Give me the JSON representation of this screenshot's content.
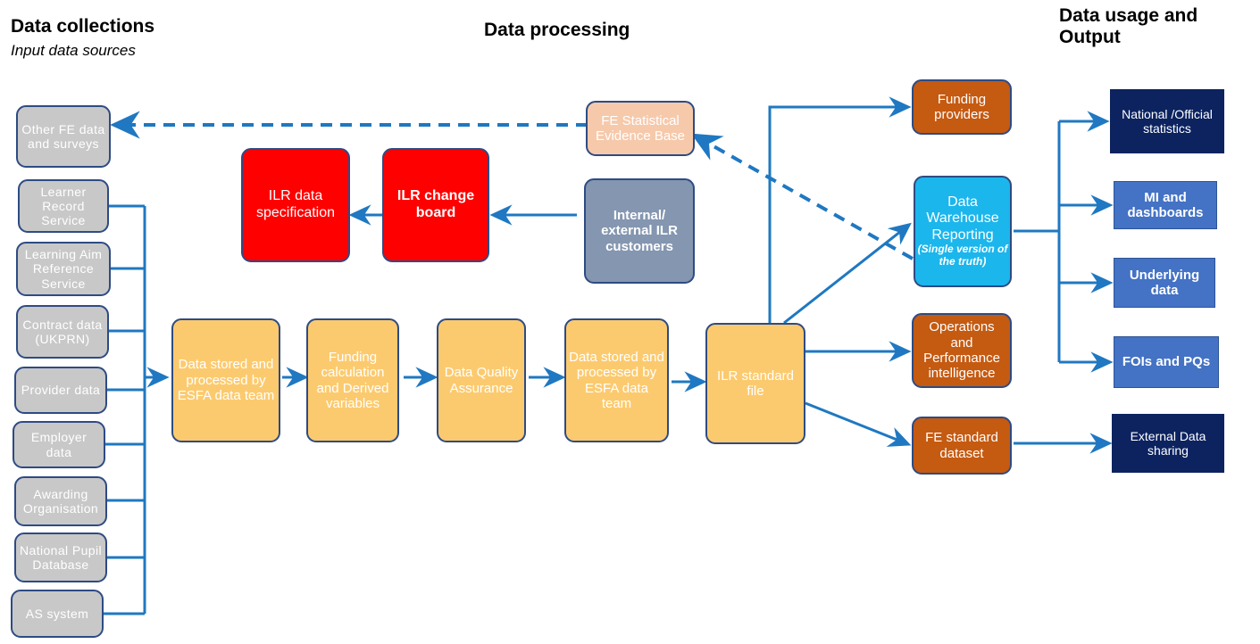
{
  "headers": [
    {
      "id": "data-collections",
      "title": "Data collections",
      "subtitle": "Input data sources"
    },
    {
      "id": "data-processing",
      "title": "Data processing",
      "subtitle": ""
    },
    {
      "id": "data-usage-output",
      "title": "Data usage and Output",
      "subtitle": ""
    }
  ],
  "colors": {
    "source_grey": "#c8c8c8",
    "process_amber": "#fcca6e",
    "red": "#fe0000",
    "peach": "#f6c9ab",
    "slate": "#8496b0",
    "orange": "#c55a11",
    "cyan": "#1bb6ec",
    "navy": "#0c2360",
    "mid_blue": "#4472c4",
    "connector_blue": "#1f78c1",
    "border_blue": "#2e4b83"
  },
  "sources": [
    {
      "id": "other-fe-data-and-surveys",
      "label": "Other FE data and surveys"
    },
    {
      "id": "learner-record-service",
      "label": "Learner Record Service"
    },
    {
      "id": "learning-aim-reference-service",
      "label": "Learning Aim Reference Service"
    },
    {
      "id": "contract-data-ukprn",
      "label": "Contract data (UKPRN)"
    },
    {
      "id": "provider-data",
      "label": "Provider data"
    },
    {
      "id": "employer-data",
      "label": "Employer data"
    },
    {
      "id": "awarding-organisation",
      "label": "Awarding Organisation"
    },
    {
      "id": "national-pupil-database",
      "label": "National Pupil Database"
    },
    {
      "id": "as-system",
      "label": "AS system"
    }
  ],
  "processing": [
    {
      "id": "data-stored-processed-esfa-1",
      "label": "Data stored and processed by ESFA data team"
    },
    {
      "id": "funding-calculation-derived-variables",
      "label": "Funding calculation and Derived variables"
    },
    {
      "id": "data-quality-assurance",
      "label": "Data Quality Assurance"
    },
    {
      "id": "data-stored-processed-esfa-2",
      "label": "Data stored and processed by ESFA data team"
    },
    {
      "id": "ilr-standard-file",
      "label": "ILR standard file"
    }
  ],
  "governance": [
    {
      "id": "ilr-data-specification",
      "label": "ILR data specification"
    },
    {
      "id": "ilr-change-board",
      "label": "ILR change board"
    },
    {
      "id": "internal-external-ilr-customers",
      "label": "Internal/ external ILR customers"
    }
  ],
  "evidence": {
    "id": "fe-statistical-evidence-base",
    "label": "FE Statistical Evidence Base"
  },
  "consumers": [
    {
      "id": "funding-providers",
      "label": "Funding providers",
      "note": ""
    },
    {
      "id": "data-warehouse-reporting",
      "label": "Data Warehouse Reporting",
      "note": "(Single version of the truth)"
    },
    {
      "id": "operations-and-performance-intelligence",
      "label": "Operations and Performance intelligence",
      "note": ""
    },
    {
      "id": "fe-standard-dataset",
      "label": "FE standard dataset",
      "note": ""
    }
  ],
  "outputs": [
    {
      "id": "national-official-statistics",
      "label": "National /Official statistics"
    },
    {
      "id": "mi-and-dashboards",
      "label": "MI and dashboards"
    },
    {
      "id": "underlying-data",
      "label": "Underlying data"
    },
    {
      "id": "fois-and-pqs",
      "label": "FOIs and PQs"
    },
    {
      "id": "external-data-sharing",
      "label": "External Data sharing"
    }
  ]
}
